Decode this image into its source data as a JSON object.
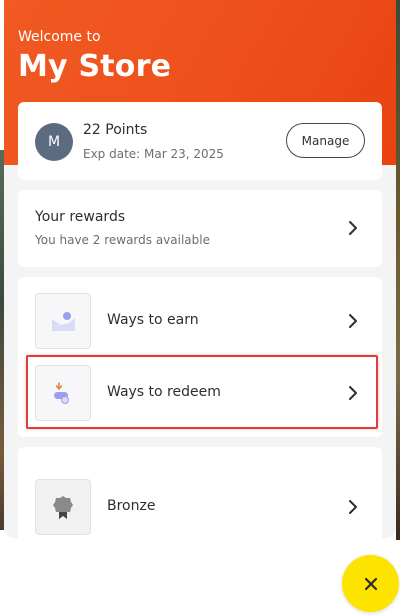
{
  "header": {
    "welcome": "Welcome to",
    "store_name": "My Store"
  },
  "points_card": {
    "avatar_initial": "M",
    "points": "22 Points",
    "exp_date": "Exp date: Mar 23, 2025",
    "manage_label": "Manage"
  },
  "rewards": {
    "title": "Your rewards",
    "subtitle": "You have 2 rewards available"
  },
  "ways": {
    "earn_label": "Ways to earn",
    "redeem_label": "Ways to redeem"
  },
  "tier": {
    "label": "Bronze"
  },
  "colors": {
    "header": "#ee4f1b",
    "fab": "#fde400",
    "avatar": "#5d6b80",
    "highlight": "#e03c3c"
  },
  "icons": {
    "earn": "earn-icon",
    "redeem": "redeem-icon",
    "tier": "medal-icon",
    "chevron": "chevron-right-icon",
    "close": "close-icon"
  }
}
